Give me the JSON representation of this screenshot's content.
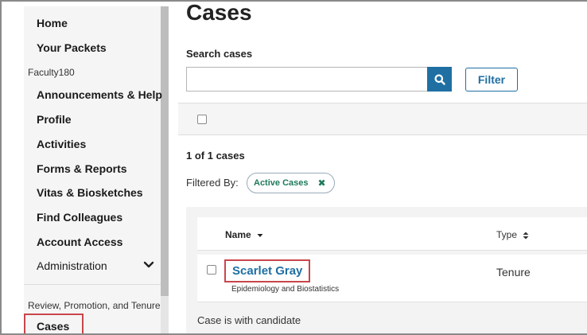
{
  "sidebar": {
    "items": [
      {
        "label": "Home"
      },
      {
        "label": "Your Packets"
      }
    ],
    "section_faculty": "Faculty180",
    "faculty_items": [
      {
        "label": "Announcements & Help"
      },
      {
        "label": "Profile"
      },
      {
        "label": "Activities"
      },
      {
        "label": "Forms & Reports"
      },
      {
        "label": "Vitas & Biosketches"
      },
      {
        "label": "Find Colleagues"
      },
      {
        "label": "Account Access"
      }
    ],
    "admin_label": "Administration",
    "section_rpt": "Review, Promotion, and Tenure",
    "active_item": "Cases"
  },
  "main": {
    "title": "Cases",
    "search": {
      "label": "Search cases",
      "value": "",
      "placeholder": ""
    },
    "filter_label": "Filter",
    "count_text": "1 of 1 cases",
    "filtered_by_label": "Filtered By:",
    "filter_chip": "Active Cases",
    "table": {
      "columns": [
        "Name",
        "Type"
      ],
      "rows": [
        {
          "name": "Scarlet Gray",
          "department": "Epidemiology and Biostatistics",
          "type": "Tenure",
          "status": "Case is with candidate"
        }
      ]
    }
  },
  "colors": {
    "accent": "#1f6fa3",
    "highlight": "#c9464b",
    "chip": "#1e7a5a"
  }
}
